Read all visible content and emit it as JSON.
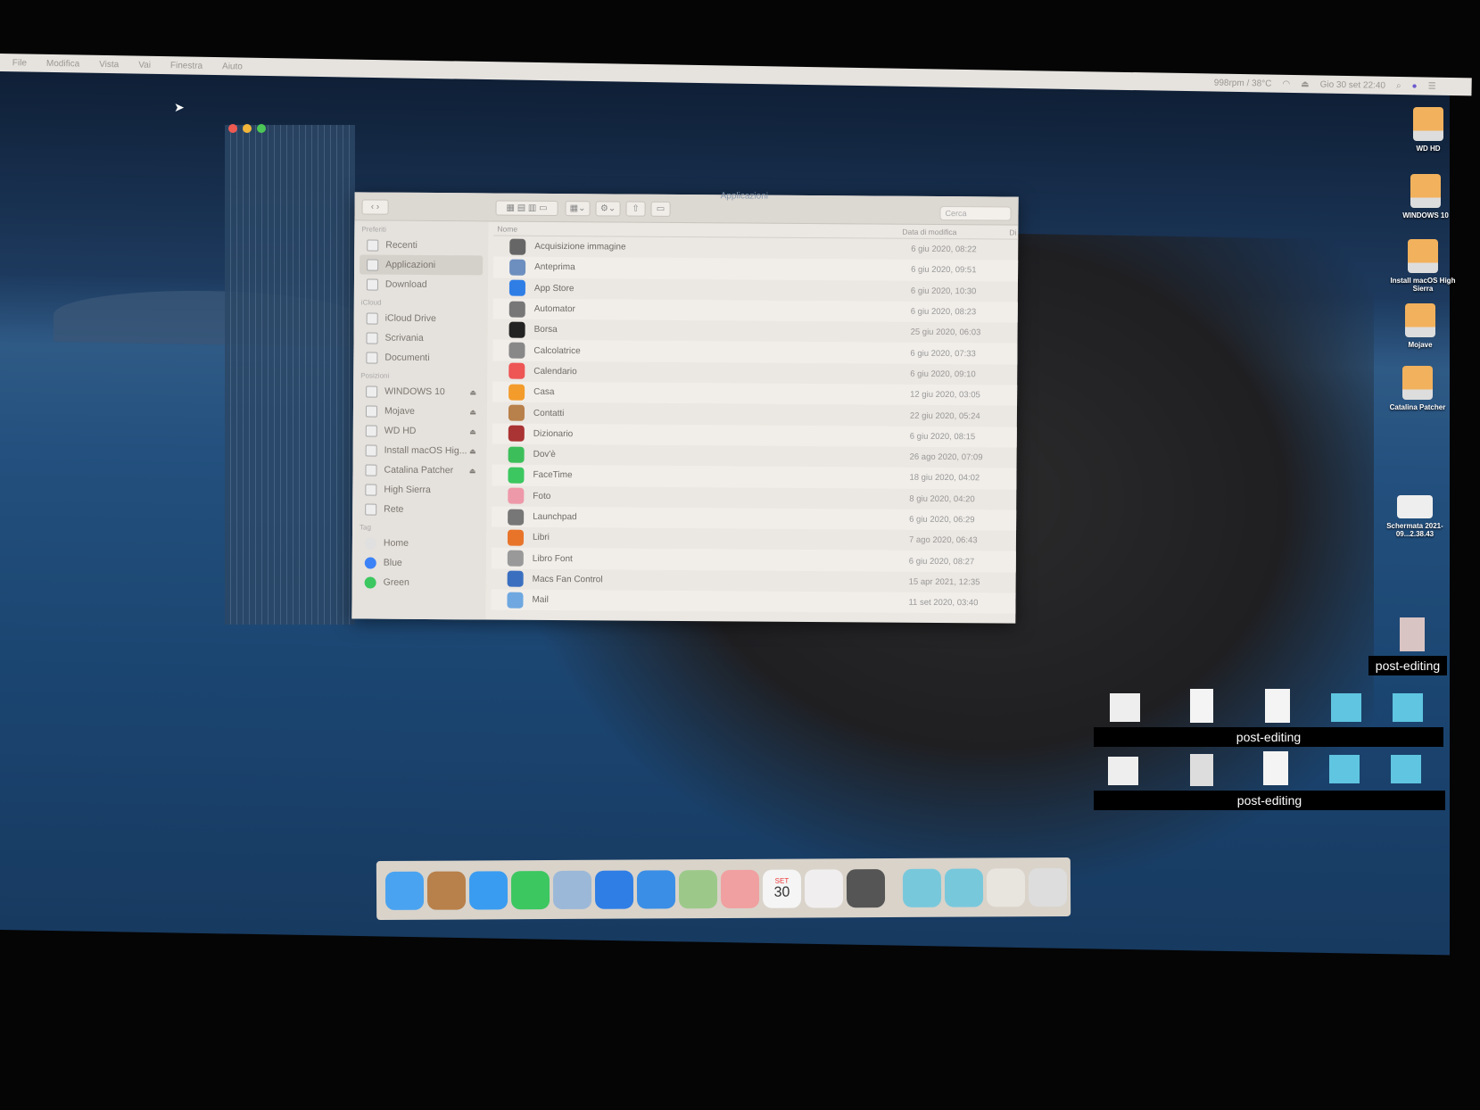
{
  "menubar": {
    "items": [
      "File",
      "Modifica",
      "Vista",
      "Vai",
      "Finestra",
      "Aiuto"
    ],
    "fan": "998rpm / 38°C",
    "datetime": "Gio 30 set  22:40"
  },
  "finder": {
    "title": "Applicazioni",
    "search_placeholder": "Cerca",
    "sidebar": [
      {
        "header": "Preferiti",
        "items": [
          {
            "label": "Recenti"
          },
          {
            "label": "Applicazioni",
            "selected": true
          },
          {
            "label": "Download"
          }
        ]
      },
      {
        "header": "iCloud",
        "items": [
          {
            "label": "iCloud Drive"
          },
          {
            "label": "Scrivania"
          },
          {
            "label": "Documenti"
          }
        ]
      },
      {
        "header": "Posizioni",
        "items": [
          {
            "label": "WINDOWS 10",
            "eject": true
          },
          {
            "label": "Mojave",
            "eject": true
          },
          {
            "label": "WD HD",
            "eject": true
          },
          {
            "label": "Install macOS Hig...",
            "eject": true
          },
          {
            "label": "Catalina Patcher",
            "eject": true
          },
          {
            "label": "High Sierra"
          },
          {
            "label": "Rete"
          }
        ]
      },
      {
        "header": "Tag",
        "items": [
          {
            "label": "Home",
            "tag": "#e0e0e0"
          },
          {
            "label": "Blue",
            "tag": "#3b82f6"
          },
          {
            "label": "Green",
            "tag": "#3cc760"
          }
        ]
      }
    ],
    "columns": {
      "name": "Nome",
      "date": "Data di modifica",
      "kind": "Di"
    },
    "rows": [
      {
        "name": "Acquisizione immagine",
        "date": "6 giu 2020, 08:22",
        "color": "#666"
      },
      {
        "name": "Anteprima",
        "date": "6 giu 2020, 09:51",
        "color": "#6d8fbf"
      },
      {
        "name": "App Store",
        "date": "6 giu 2020, 10:30",
        "color": "#2f7ee6"
      },
      {
        "name": "Automator",
        "date": "6 giu 2020, 08:23",
        "color": "#777"
      },
      {
        "name": "Borsa",
        "date": "25 giu 2020, 06:03",
        "color": "#222"
      },
      {
        "name": "Calcolatrice",
        "date": "6 giu 2020, 07:33",
        "color": "#888"
      },
      {
        "name": "Calendario",
        "date": "6 giu 2020, 09:10",
        "color": "#e55"
      },
      {
        "name": "Casa",
        "date": "12 giu 2020, 03:05",
        "color": "#f39c2c"
      },
      {
        "name": "Contatti",
        "date": "22 giu 2020, 05:24",
        "color": "#b8804a"
      },
      {
        "name": "Dizionario",
        "date": "6 giu 2020, 08:15",
        "color": "#a33"
      },
      {
        "name": "Dov'è",
        "date": "26 ago 2020, 07:09",
        "color": "#3cbf5a"
      },
      {
        "name": "FaceTime",
        "date": "18 giu 2020, 04:02",
        "color": "#3cc760"
      },
      {
        "name": "Foto",
        "date": "8 giu 2020, 04:20",
        "color": "#e9a"
      },
      {
        "name": "Launchpad",
        "date": "6 giu 2020, 06:29",
        "color": "#777"
      },
      {
        "name": "Libri",
        "date": "7 ago 2020, 06:43",
        "color": "#e8742a"
      },
      {
        "name": "Libro Font",
        "date": "6 giu 2020, 08:27",
        "color": "#999"
      },
      {
        "name": "Macs Fan Control",
        "date": "15 apr 2021, 12:35",
        "color": "#3a6fc0"
      },
      {
        "name": "Mail",
        "date": "11 set 2020, 03:40",
        "color": "#6fa8e0"
      }
    ]
  },
  "desktop": {
    "icons": [
      "WD HD",
      "WINDOWS 10",
      "Install macOS High Sierra",
      "Mojave",
      "Catalina Patcher",
      "Schermata 2021-09...2.38.43"
    ],
    "redaction_label": "post-editing"
  },
  "dock": {
    "apps": [
      {
        "name": "finder",
        "color": "#4aa3f0"
      },
      {
        "name": "contacts",
        "color": "#b8804a"
      },
      {
        "name": "messages",
        "color": "#3a9cf0"
      },
      {
        "name": "facetime",
        "color": "#3cc760"
      },
      {
        "name": "mail",
        "color": "#9bb8d8"
      },
      {
        "name": "app-store",
        "color": "#2f7ee6"
      },
      {
        "name": "safari",
        "color": "#3a8ee6"
      },
      {
        "name": "maps",
        "color": "#9cc98a"
      },
      {
        "name": "photos",
        "color": "#f0a0a0"
      },
      {
        "name": "calendar",
        "color": "#f5f5f5"
      },
      {
        "name": "music",
        "color": "#f0eeee"
      },
      {
        "name": "system-preferences",
        "color": "#555"
      },
      {
        "name": "applications-folder",
        "color": "#78c8dc"
      },
      {
        "name": "downloads-folder",
        "color": "#78c8dc"
      },
      {
        "name": "document",
        "color": "#e8e4de"
      },
      {
        "name": "trash",
        "color": "#ddd"
      }
    ],
    "calendar_month": "SET",
    "calendar_day": "30"
  }
}
